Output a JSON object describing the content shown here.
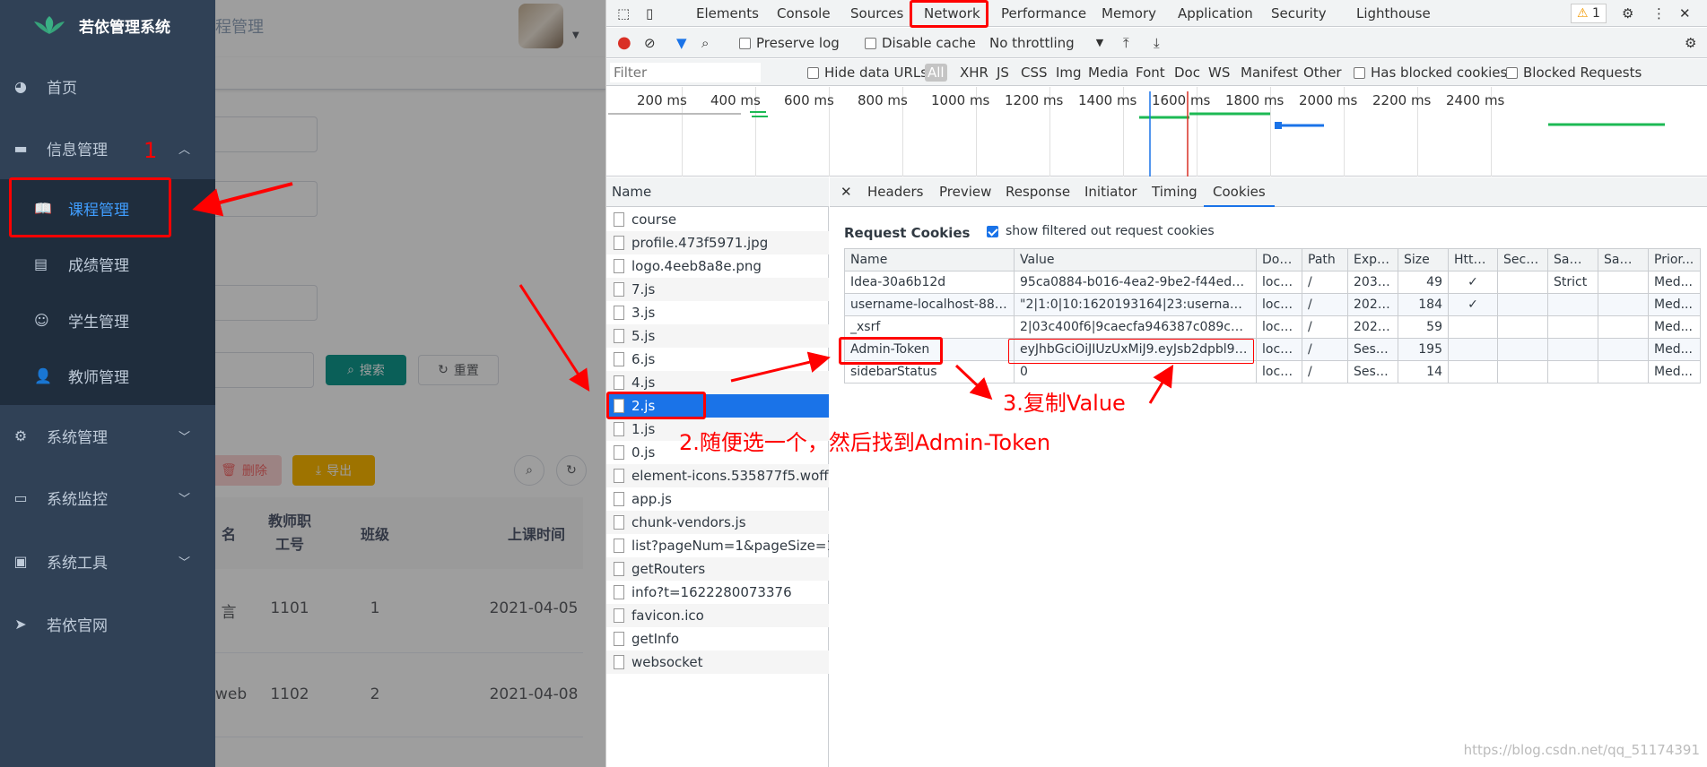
{
  "app": {
    "title": "若依管理系统",
    "breadcrumb": "程管理",
    "menu": [
      {
        "label": "首页",
        "icon": "dashboard-icon"
      },
      {
        "label": "信息管理",
        "icon": "message-icon"
      },
      {
        "label": "系统管理",
        "icon": "gear-icon"
      },
      {
        "label": "系统监控",
        "icon": "monitor-icon"
      },
      {
        "label": "系统工具",
        "icon": "toolbox-icon"
      },
      {
        "label": "若依官网",
        "icon": "paper-plane-icon"
      }
    ],
    "submenu": [
      {
        "label": "课程管理",
        "icon": "book-icon"
      },
      {
        "label": "成绩管理",
        "icon": "document-icon"
      },
      {
        "label": "学生管理",
        "icon": "student-icon"
      },
      {
        "label": "教师管理",
        "icon": "teacher-icon"
      }
    ],
    "buttons": {
      "search": "搜索",
      "reset": "重置",
      "delete": "删除",
      "export": "导出"
    },
    "table": {
      "headers": [
        "名",
        "教师职工号",
        "班级",
        "上课时间"
      ],
      "rows": [
        [
          "言",
          "1101",
          "1",
          "2021-04-05"
        ],
        [
          "web",
          "1102",
          "2",
          "2021-04-08"
        ]
      ]
    }
  },
  "devtools": {
    "tabs": [
      "Elements",
      "Console",
      "Sources",
      "Network",
      "Performance",
      "Memory",
      "Application",
      "Security",
      "Lighthouse"
    ],
    "active_tab": "Network",
    "warning_count": "1",
    "toolbar": {
      "preserve_log": "Preserve log",
      "disable_cache": "Disable cache",
      "throttling": "No throttling"
    },
    "filter": {
      "placeholder": "Filter",
      "hide_data_urls": "Hide data URLs",
      "types": [
        "All",
        "XHR",
        "JS",
        "CSS",
        "Img",
        "Media",
        "Font",
        "Doc",
        "WS",
        "Manifest",
        "Other"
      ],
      "blocked_cookies": "Has blocked cookies",
      "blocked_requests": "Blocked Requests"
    },
    "timeline_ticks": [
      "200 ms",
      "400 ms",
      "600 ms",
      "800 ms",
      "1000 ms",
      "1200 ms",
      "1400 ms",
      "1600 ms",
      "1800 ms",
      "2000 ms",
      "2200 ms",
      "2400 ms"
    ],
    "name_header": "Name",
    "files": [
      "course",
      "profile.473f5971.jpg",
      "logo.4eeb8a8e.png",
      "7.js",
      "3.js",
      "5.js",
      "6.js",
      "4.js",
      "2.js",
      "1.js",
      "0.js",
      "element-icons.535877f5.woff",
      "app.js",
      "chunk-vendors.js",
      "list?pageNum=1&pageSize=10",
      "getRouters",
      "info?t=1622280073376",
      "favicon.ico",
      "getInfo",
      "websocket"
    ],
    "selected_file": "2.js",
    "detail_tabs": [
      "Headers",
      "Preview",
      "Response",
      "Initiator",
      "Timing",
      "Cookies"
    ],
    "active_detail_tab": "Cookies",
    "request_cookies_title": "Request Cookies",
    "show_filtered_label": "show filtered out request cookies",
    "cookie_headers": [
      "Name",
      "Value",
      "Dom...",
      "Path",
      "Expir...",
      "Size",
      "Http...",
      "Secu...",
      "Sam...",
      "Sam...",
      "Prior..."
    ],
    "cookies": [
      [
        "Idea-30a6b12d",
        "95ca0884-b016-4ea2-9be2-f44edd0...",
        "local...",
        "/",
        "2031...",
        "49",
        "✓",
        "",
        "Strict",
        "",
        "Med..."
      ],
      [
        "username-localhost-8888",
        "\"2|1:0|10:1620193164|23:username-l...",
        "local...",
        "/",
        "2021...",
        "184",
        "✓",
        "",
        "",
        "",
        "Med..."
      ],
      [
        "_xsrf",
        "2|03c400f6|9caecfa946387c089c57f3...",
        "local...",
        "/",
        "2021...",
        "59",
        "",
        "",
        "",
        "",
        "Med..."
      ],
      [
        "Admin-Token",
        "eyJhbGciOiJIUzUxMiJ9.eyJsb2dpbl91...",
        "local...",
        "/",
        "Sessi...",
        "195",
        "",
        "",
        "",
        "",
        "Med..."
      ],
      [
        "sidebarStatus",
        "0",
        "local...",
        "/",
        "Sessi...",
        "14",
        "",
        "",
        "",
        "",
        "Med..."
      ]
    ]
  },
  "annotations": {
    "step1": "1",
    "step2": "2.随便选一个，然后找到Admin-Token",
    "step3": "3.复制Value"
  },
  "colors": {
    "sidebar": "#304156",
    "submenu": "#1f2d3d",
    "accent": "#409eff",
    "annotation": "#ff0000",
    "devtools_blue": "#1a73e8"
  },
  "watermark": "https://blog.csdn.net/qq_51174391"
}
